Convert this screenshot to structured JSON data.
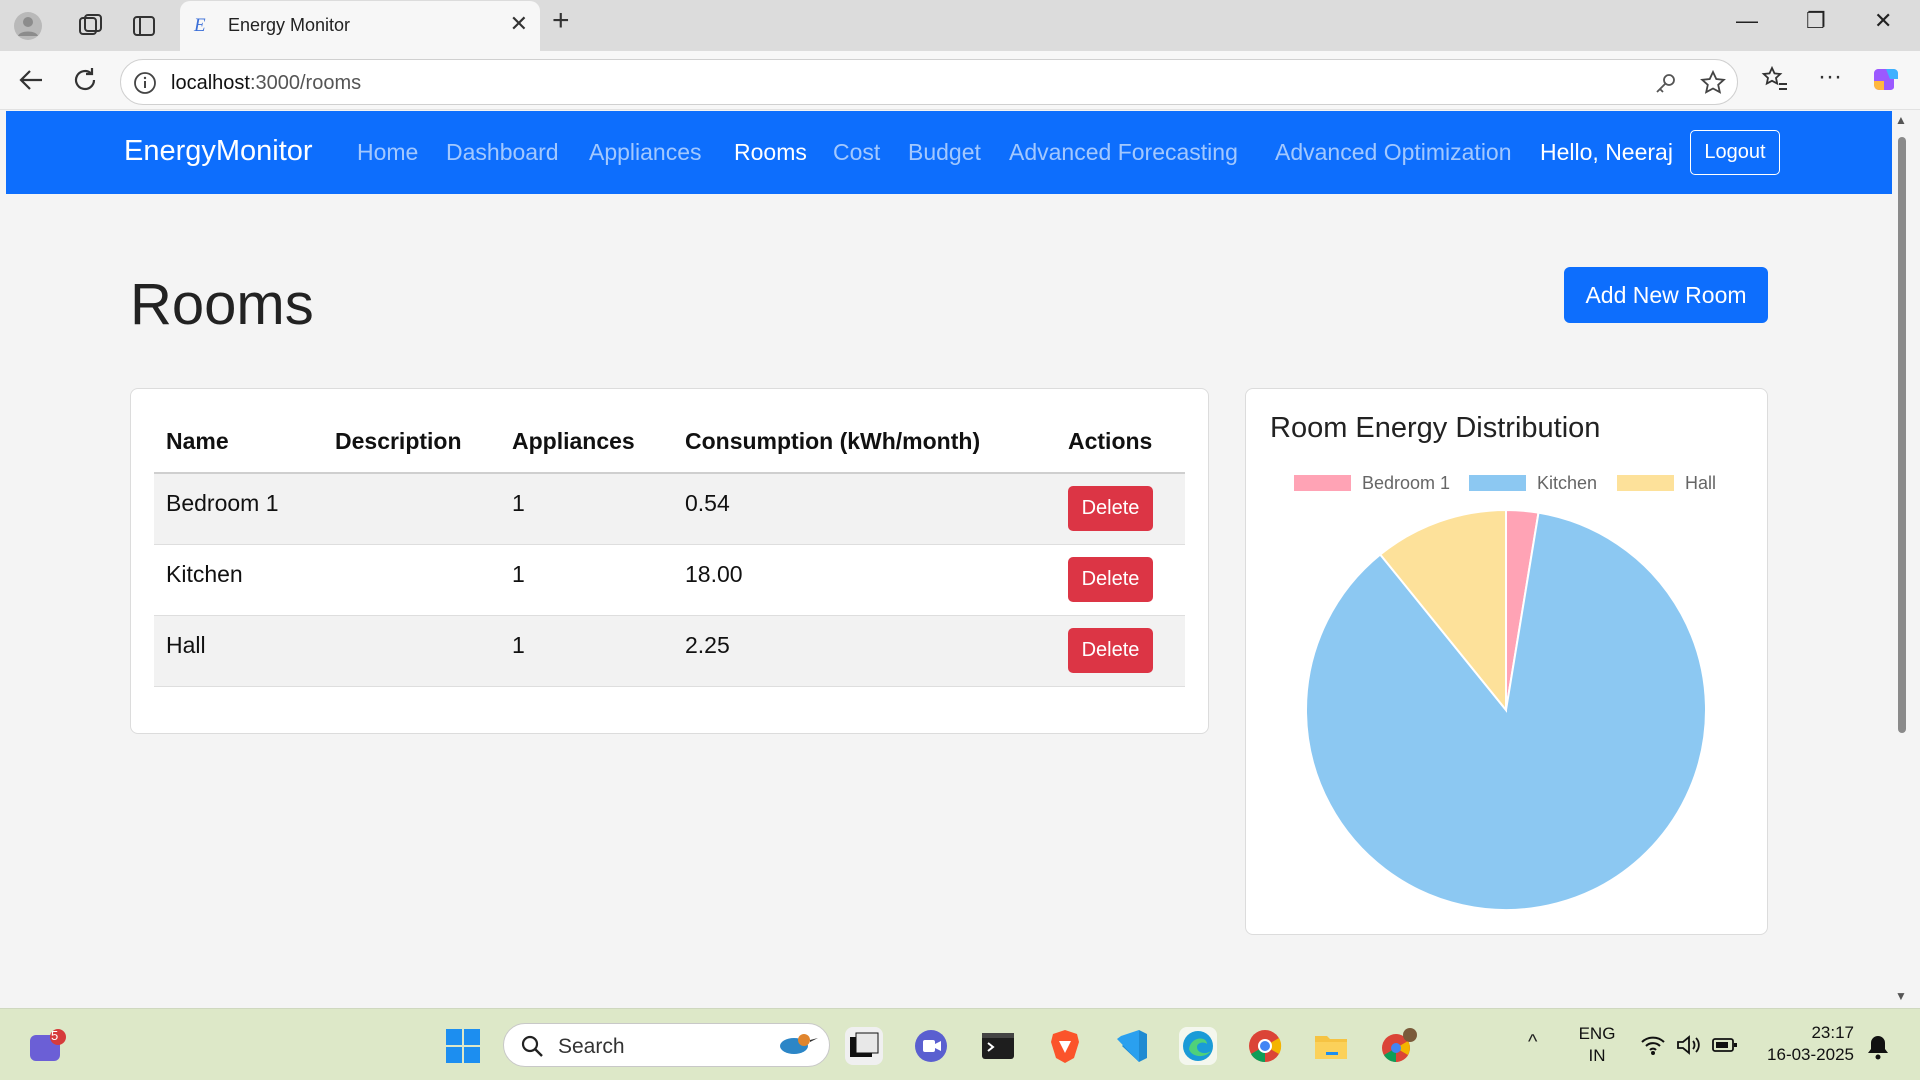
{
  "browser": {
    "tab_title": "Energy Monitor",
    "tab_favicon": "E",
    "url_host": "localhost",
    "url_path": ":3000/rooms"
  },
  "navbar": {
    "brand": "EnergyMonitor",
    "links": [
      "Home",
      "Dashboard",
      "Appliances",
      "Rooms",
      "Cost",
      "Budget",
      "Advanced Forecasting",
      "Advanced Optimization"
    ],
    "active": "Rooms",
    "greeting": "Hello, Neeraj",
    "logout_label": "Logout"
  },
  "page": {
    "title": "Rooms",
    "add_button_label": "Add New Room"
  },
  "rooms_table": {
    "headers": [
      "Name",
      "Description",
      "Appliances",
      "Consumption (kWh/month)",
      "Actions"
    ],
    "rows": [
      {
        "name": "Bedroom 1",
        "description": "",
        "appliances": "1",
        "consumption": "0.54",
        "action": "Delete"
      },
      {
        "name": "Kitchen",
        "description": "",
        "appliances": "1",
        "consumption": "18.00",
        "action": "Delete"
      },
      {
        "name": "Hall",
        "description": "",
        "appliances": "1",
        "consumption": "2.25",
        "action": "Delete"
      }
    ]
  },
  "chart_card": {
    "title": "Room Energy Distribution"
  },
  "chart_data": {
    "type": "pie",
    "title": "Room Energy Distribution",
    "categories": [
      "Bedroom 1",
      "Kitchen",
      "Hall"
    ],
    "values": [
      0.54,
      18.0,
      2.25
    ],
    "colors": [
      "#ffa3b5",
      "#8cc8f2",
      "#fde19a"
    ],
    "legend_position": "top"
  },
  "taskbar": {
    "search_label": "Search",
    "notification_count": "5",
    "lang_line1": "ENG",
    "lang_line2": "IN",
    "time": "23:17",
    "date": "16-03-2025"
  }
}
